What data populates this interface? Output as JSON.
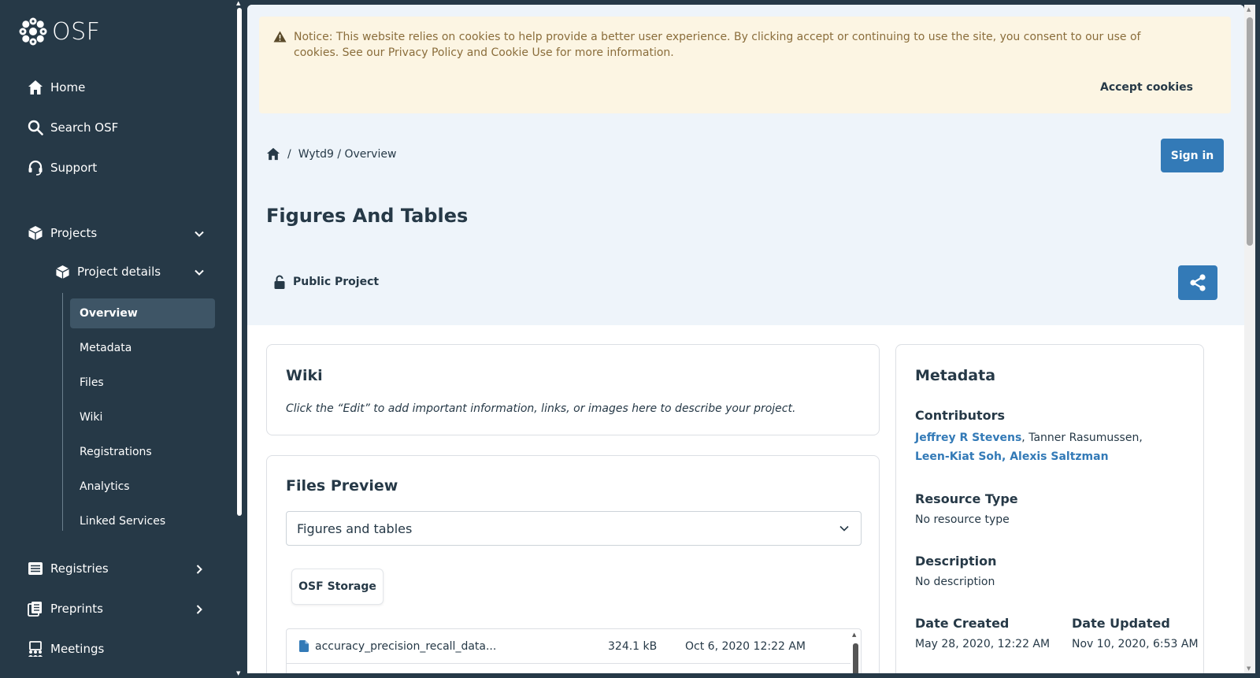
{
  "brand": {
    "name": "OSF"
  },
  "sidebar": {
    "home": "Home",
    "search": "Search OSF",
    "support": "Support",
    "projects": "Projects",
    "project_details": "Project details",
    "leaves": [
      "Overview",
      "Metadata",
      "Files",
      "Wiki",
      "Registrations",
      "Analytics",
      "Linked Services"
    ],
    "active_leaf": "Overview",
    "registries": "Registries",
    "preprints": "Preprints",
    "meetings": "Meetings"
  },
  "cookie_notice": {
    "text": "Notice: This website relies on cookies to help provide a better user experience. By clicking accept or continuing to use the site, you consent to our use of cookies. See our Privacy Policy and Cookie Use for more information.",
    "accept_label": "Accept cookies"
  },
  "breadcrumb": {
    "sep": "/",
    "path": "Wytd9 / Overview"
  },
  "header": {
    "sign_in": "Sign in",
    "title": "Figures And Tables",
    "visibility": "Public Project"
  },
  "wiki": {
    "title": "Wiki",
    "hint": "Click the “Edit” to add important information, links, or images here to describe your project."
  },
  "files_preview": {
    "title": "Files Preview",
    "selected": "Figures and tables",
    "storage_label": "OSF Storage",
    "files": [
      {
        "name": "accuracy_precision_recall_data...",
        "size": "324.1 kB",
        "date": "Oct 6, 2020 12:22 AM"
      }
    ]
  },
  "metadata": {
    "title": "Metadata",
    "contributors_label": "Contributors",
    "contributors": {
      "c1": "Jeffrey R Stevens",
      "sep1": ", ",
      "c2": "Tanner Rasumussen,",
      "c3": "Leen-Kiat Soh, Alexis Saltzman"
    },
    "resource_type_label": "Resource Type",
    "resource_type": "No resource type",
    "description_label": "Description",
    "description": "No description",
    "date_created_label": "Date Created",
    "date_created": "May 28, 2020, 12:22 AM",
    "date_updated_label": "Date Updated",
    "date_updated": "Nov 10, 2020, 6:53 AM"
  },
  "colors": {
    "sidebar_bg": "#263947",
    "primary": "#337ab7",
    "hero_bg": "#eef4fa",
    "notice_bg": "#fcf5e3"
  }
}
